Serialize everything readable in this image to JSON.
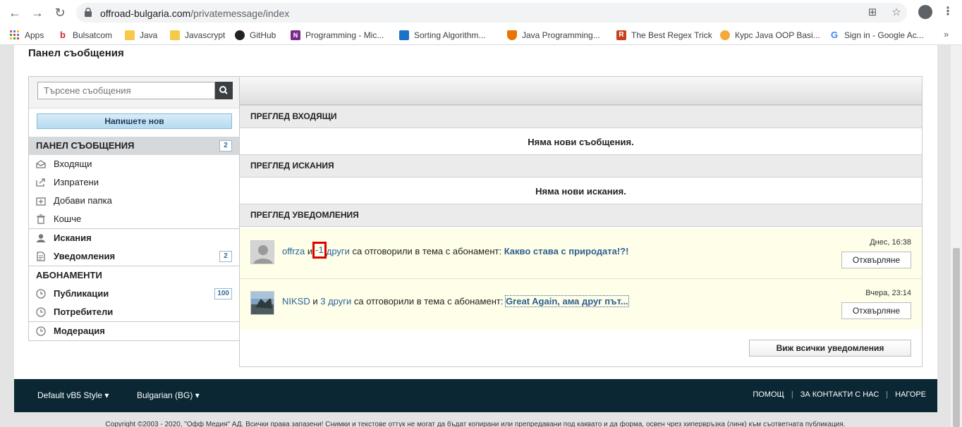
{
  "browser": {
    "url_host": "offroad-bulgaria.com",
    "url_path": "/privatemessage/index",
    "bookmarks": [
      {
        "label": "Apps",
        "icon": "apps-grid-icon",
        "color": "#e94235"
      },
      {
        "label": "Bulsatcom",
        "icon": "bulsatcom-icon",
        "color": "#d8232a"
      },
      {
        "label": "Java",
        "icon": "folder-icon",
        "color": "#f7c948"
      },
      {
        "label": "Javascrypt",
        "icon": "folder-icon",
        "color": "#f7c948"
      },
      {
        "label": "GitHub",
        "icon": "github-icon",
        "color": "#222222"
      },
      {
        "label": "Programming - Mic...",
        "icon": "onenote-icon",
        "color": "#7a2a8c"
      },
      {
        "label": "Sorting Algorithm...",
        "icon": "sorting-icon",
        "color": "#1a73c8"
      },
      {
        "label": "Java Programming...",
        "icon": "princeton-icon",
        "color": "#e77500"
      },
      {
        "label": "The Best Regex Trick",
        "icon": "regex-icon",
        "color": "#c9401f"
      },
      {
        "label": "Курс Java OOP Basi...",
        "icon": "softuni-icon",
        "color": "#f3a93c"
      },
      {
        "label": "Sign in - Google Ac...",
        "icon": "google-icon",
        "color": "#4285f4"
      }
    ],
    "more": "»"
  },
  "page": {
    "title": "Панел съобщения",
    "search_placeholder": "Търсене съобщения",
    "compose_label": "Напишете нов"
  },
  "sidebar": {
    "panel_heading": "ПАНЕЛ СЪОБЩЕНИЯ",
    "panel_badge": "2",
    "messages": [
      {
        "label": "Входящи",
        "icon": "inbox-icon"
      },
      {
        "label": "Изпратени",
        "icon": "sent-icon"
      },
      {
        "label": "Добави папка",
        "icon": "add-folder-icon"
      },
      {
        "label": "Кошче",
        "icon": "trash-icon"
      }
    ],
    "requests_label": "Искания",
    "notifications_label": "Уведомления",
    "notifications_badge": "2",
    "subscriptions_heading": "АБОНАМЕНТИ",
    "publications_label": "Публикации",
    "publications_badge": "100",
    "users_label": "Потребители",
    "moderation_label": "Модерация"
  },
  "main": {
    "inbox_heading": "ПРЕГЛЕД ВХОДЯЩИ",
    "inbox_empty": "Няма нови съобщения.",
    "requests_heading": "ПРЕГЛЕД ИСКАНИЯ",
    "requests_empty": "Няма нови искания.",
    "notifications_heading": "ПРЕГЛЕД УВЕДОМЛЕНИЯ",
    "notifications": [
      {
        "user": "offrza",
        "conj": "и",
        "count": "-1",
        "others": "други",
        "action": "са отговорили в тема с абонамент:",
        "topic": "Какво става с природата!?!",
        "date": "Днес, 16:38",
        "dismiss": "Отхвърляне"
      },
      {
        "user": "NIKSD",
        "conj": "и",
        "count_others": "3 други",
        "action": "са отговорили в тема с абонамент:",
        "topic": "Great Again, ама друг път...",
        "date": "Вчера, 23:14",
        "dismiss": "Отхвърляне"
      }
    ],
    "view_all": "Виж всички уведомления"
  },
  "footer": {
    "style_select": "Default vB5 Style",
    "lang_select": "Bulgarian (BG)",
    "help": "ПОМОЩ",
    "contact": "ЗА КОНТАКТИ С НАС",
    "top": "НАГОРЕ",
    "copyright": "Copyright ©2003 - 2020, \"Офф Медия\" АД. Всички права запазени! Снимки и текстове оттук не могат да бъдат копирани или препредавани под каквато и да форма, освен чрез хипервръзка (линк) към съответната публикация."
  },
  "colors": {
    "footer_bg": "#0a2733",
    "link": "#2a6496",
    "notif_bg": "#fefee9",
    "highlight": "#e00000"
  }
}
